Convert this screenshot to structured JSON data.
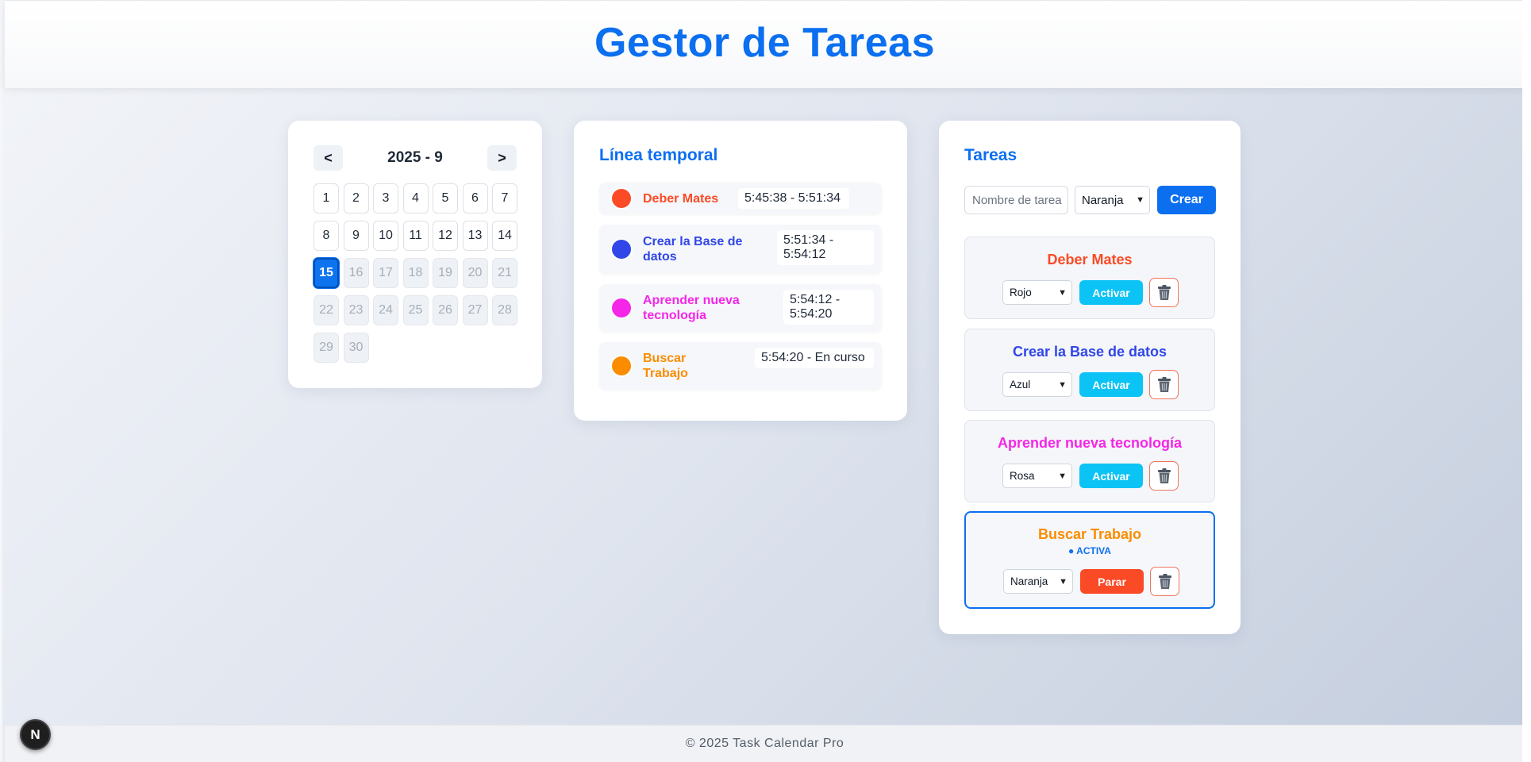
{
  "header": {
    "title": "Gestor de Tareas"
  },
  "calendar": {
    "prev_label": "<",
    "next_label": ">",
    "month_label": "2025 - 9",
    "days": [
      {
        "n": "1",
        "state": "normal"
      },
      {
        "n": "2",
        "state": "normal"
      },
      {
        "n": "3",
        "state": "normal"
      },
      {
        "n": "4",
        "state": "normal"
      },
      {
        "n": "5",
        "state": "normal"
      },
      {
        "n": "6",
        "state": "normal"
      },
      {
        "n": "7",
        "state": "normal"
      },
      {
        "n": "8",
        "state": "normal"
      },
      {
        "n": "9",
        "state": "normal"
      },
      {
        "n": "10",
        "state": "normal"
      },
      {
        "n": "11",
        "state": "normal"
      },
      {
        "n": "12",
        "state": "normal"
      },
      {
        "n": "13",
        "state": "normal"
      },
      {
        "n": "14",
        "state": "normal"
      },
      {
        "n": "15",
        "state": "today"
      },
      {
        "n": "16",
        "state": "muted"
      },
      {
        "n": "17",
        "state": "muted"
      },
      {
        "n": "18",
        "state": "muted"
      },
      {
        "n": "19",
        "state": "muted"
      },
      {
        "n": "20",
        "state": "muted"
      },
      {
        "n": "21",
        "state": "muted"
      },
      {
        "n": "22",
        "state": "muted"
      },
      {
        "n": "23",
        "state": "muted"
      },
      {
        "n": "24",
        "state": "muted"
      },
      {
        "n": "25",
        "state": "muted"
      },
      {
        "n": "26",
        "state": "muted"
      },
      {
        "n": "27",
        "state": "muted"
      },
      {
        "n": "28",
        "state": "muted"
      },
      {
        "n": "29",
        "state": "muted"
      },
      {
        "n": "30",
        "state": "muted"
      }
    ]
  },
  "timeline": {
    "title": "Línea temporal",
    "items": [
      {
        "name": "Deber Mates",
        "time": "5:45:38 - 5:51:34",
        "color": "#fb4a26"
      },
      {
        "name": "Crear la Base de datos",
        "time": "5:51:34 - 5:54:12",
        "color": "#3146e8"
      },
      {
        "name": "Aprender nueva tecnología",
        "time": "5:54:12 - 5:54:20",
        "color": "#f526e8"
      },
      {
        "name": "Buscar Trabajo",
        "time": "5:54:20 - En curso",
        "color": "#fb8c00"
      }
    ]
  },
  "tasks": {
    "title": "Tareas",
    "name_placeholder": "Nombre de tarea",
    "new_color": "Naranja",
    "create_label": "Crear",
    "items": [
      {
        "name": "Deber Mates",
        "color_label": "Rojo",
        "color": "#fb4a26",
        "action": "Activar",
        "active": false
      },
      {
        "name": "Crear la Base de datos",
        "color_label": "Azul",
        "color": "#3146e8",
        "action": "Activar",
        "active": false
      },
      {
        "name": "Aprender nueva tecnología",
        "color_label": "Rosa",
        "color": "#f526e8",
        "action": "Activar",
        "active": false
      },
      {
        "name": "Buscar Trabajo",
        "color_label": "Naranja",
        "color": "#fb8c00",
        "action": "Parar",
        "active": true,
        "badge": "● ACTIVA"
      }
    ]
  },
  "footer": {
    "text": "© 2025 Task Calendar Pro"
  },
  "next_badge": {
    "label": "N"
  },
  "icons": {
    "delete": "trash-icon",
    "dropdown": "chevron-down-icon"
  }
}
